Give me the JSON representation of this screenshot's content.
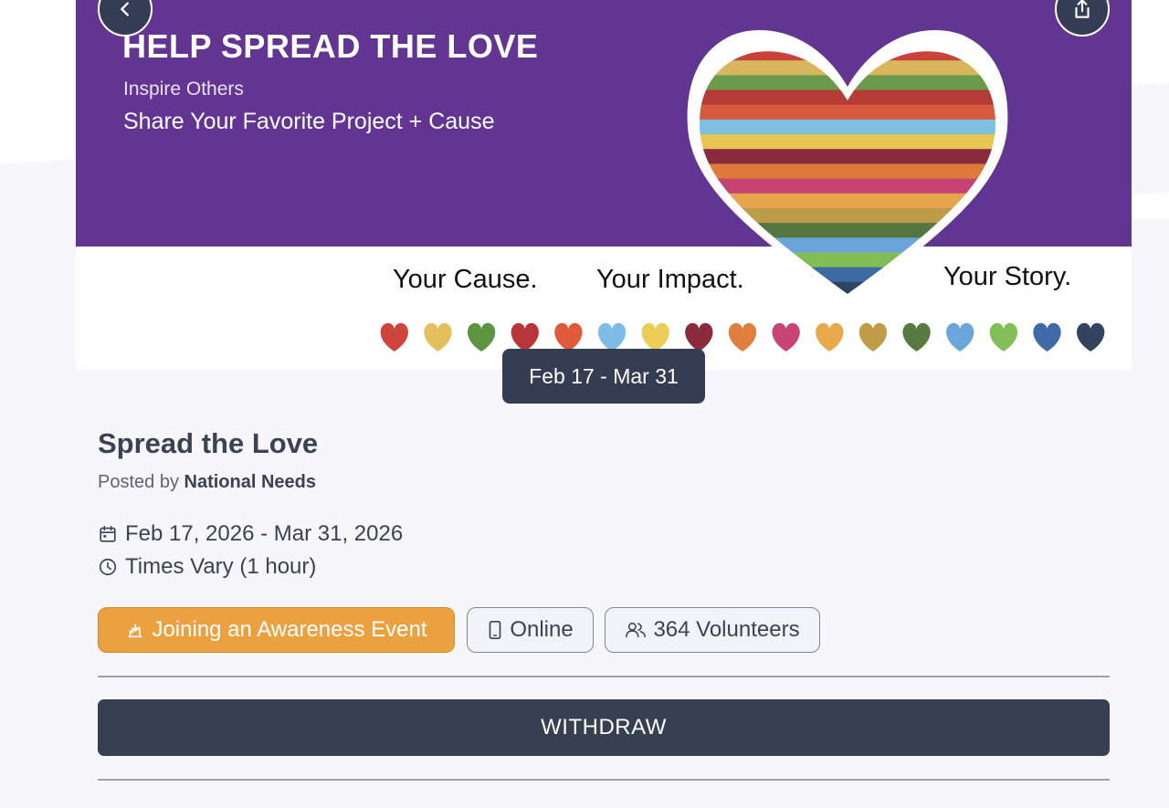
{
  "banner": {
    "title": "HELP SPREAD THE LOVE",
    "subtitle": "Inspire Others",
    "tagline": "Share Your Favorite Project + Cause",
    "taglines": [
      "Your Cause.",
      "Your Impact.",
      "Your Story."
    ],
    "heart_stripe_colors": [
      "#c9433c",
      "#d8b65e",
      "#6a9a4c",
      "#b53b35",
      "#d65a3c",
      "#7fc0e0",
      "#e6c653",
      "#8b2a3e",
      "#de7b3b",
      "#c54372",
      "#e4a54d",
      "#bd9b48",
      "#55763f",
      "#6aa4d9",
      "#7fbe55",
      "#3d6aa2",
      "#2f4466"
    ],
    "mini_heart_colors": [
      "#d0443e",
      "#e3c05c",
      "#5c9440",
      "#b8363a",
      "#e05a3a",
      "#7dbde5",
      "#ebcd58",
      "#8a2a3c",
      "#e07f3d",
      "#c84472",
      "#e9a84a",
      "#c09c48",
      "#587a40",
      "#6aa6dc",
      "#84be58",
      "#3e6aa6",
      "#31435f"
    ]
  },
  "nav": {
    "back_icon": "chevron-left-icon",
    "share_icon": "share-icon"
  },
  "date_pill": "Feb 17 - Mar 31",
  "event": {
    "title": "Spread the Love",
    "posted_by_prefix": "Posted by",
    "organizer": "National Needs",
    "date_range": "Feb 17, 2026 - Mar 31, 2026",
    "time": "Times Vary (1 hour)"
  },
  "chips": {
    "category": "Joining an Awareness Event",
    "location": "Online",
    "volunteers": "364 Volunteers"
  },
  "actions": {
    "withdraw": "WITHDRAW"
  },
  "colors": {
    "accent_orange": "#eba140",
    "dark": "#364052",
    "purple": "#633593"
  }
}
